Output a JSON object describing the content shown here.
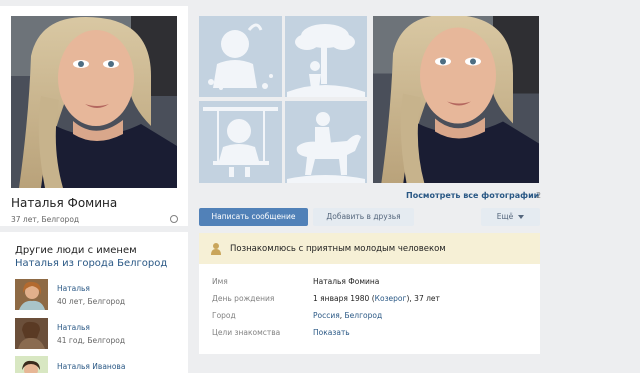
{
  "profile": {
    "name": "Наталья Фомина",
    "info": "37 лет, Белгород",
    "avatar_icon": "portrait-photo"
  },
  "photos": {
    "all_link": "Посмотреть все фотографии",
    "count": "2",
    "placeholder_icons": [
      "child-balloon-icon",
      "child-tree-icon",
      "child-swing-icon",
      "child-horse-icon"
    ]
  },
  "actions": {
    "message": "Написать сообщение",
    "add_friend": "Добавить в друзья",
    "more": "Ещё"
  },
  "status": {
    "icon": "person-icon",
    "text": "Познакомлюсь с приятным молодым человеком"
  },
  "details": {
    "name_label": "Имя",
    "name_value": "Наталья Фомина",
    "birthday_label": "День рождения",
    "birthday_date": "1 января 1980",
    "birthday_sign": "Козерог",
    "birthday_age": ", 37 лет",
    "city_label": "Город",
    "country": "Россия",
    "city": "Белгород",
    "goals_label": "Цели знакомства",
    "goals_link": "Показать"
  },
  "others": {
    "title": "Другие люди с именем",
    "subtitle": "Наталья из города Белгород",
    "people": [
      {
        "name": "Наталья",
        "info": "40 лет, Белгород"
      },
      {
        "name": "Наталья",
        "info": "41 год, Белгород"
      },
      {
        "name": "Наталья Иванова",
        "info": ""
      }
    ]
  },
  "colors": {
    "accent": "#5181b8",
    "link": "#2a5885",
    "status_bg": "#f6f0d6",
    "page_bg": "#edeef0"
  }
}
